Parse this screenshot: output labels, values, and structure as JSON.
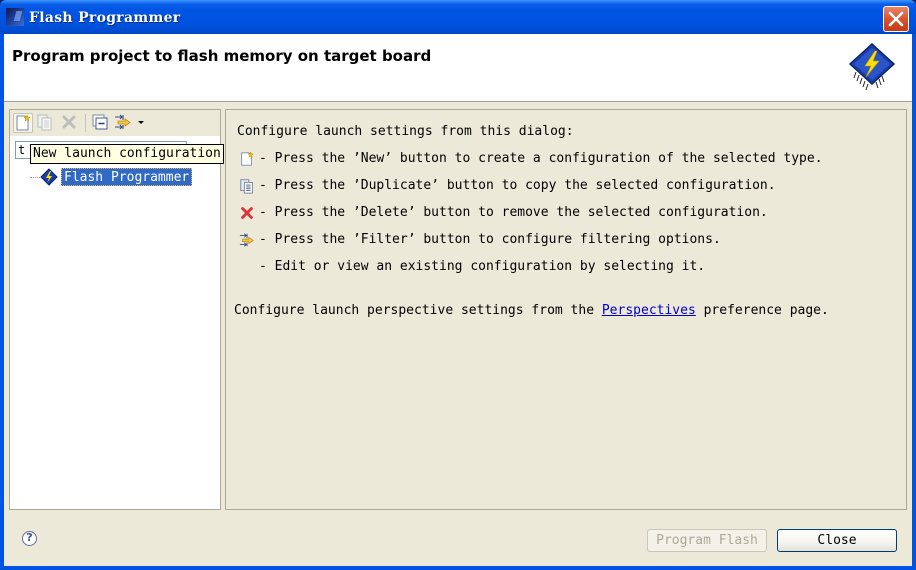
{
  "window": {
    "title": "Flash Programmer",
    "app_icon": "flash-programmer-app-icon",
    "close_icon": "close-icon"
  },
  "header": {
    "title": "Program project to flash memory on target board",
    "icon": "flash-chip-icon"
  },
  "toolbar": {
    "buttons": [
      {
        "name": "new-launch-config",
        "icon": "new-config-icon",
        "enabled": true
      },
      {
        "name": "duplicate",
        "icon": "duplicate-icon",
        "enabled": false
      },
      {
        "name": "delete",
        "icon": "delete-icon",
        "enabled": false
      },
      {
        "name": "collapse-all",
        "icon": "collapse-all-icon",
        "enabled": true
      },
      {
        "name": "filter",
        "icon": "filter-icon",
        "enabled": true
      },
      {
        "name": "view-menu",
        "icon": "dropdown-arrow-icon",
        "enabled": true
      }
    ]
  },
  "filter": {
    "value": "t"
  },
  "tooltip": {
    "text": "New launch configuration"
  },
  "tree": {
    "items": [
      {
        "label": "Flash Programmer",
        "icon": "flash-programmer-icon",
        "selected": true
      }
    ]
  },
  "content": {
    "intro": "Configure launch settings from this dialog:",
    "lines": [
      {
        "icon": "new-config-icon",
        "text": "- Press the ’New’ button to create a configuration of the selected type."
      },
      {
        "icon": "duplicate-icon",
        "text": "- Press the ’Duplicate’ button to copy the selected configuration."
      },
      {
        "icon": "delete-icon",
        "text": "- Press the ’Delete’ button to remove the selected configuration."
      },
      {
        "icon": "filter-icon",
        "text": "- Press the ’Filter’ button to configure filtering options."
      },
      {
        "icon": "",
        "text": "- Edit or view an existing configuration by selecting it."
      }
    ],
    "perspective_prefix": "Configure launch perspective settings from the ",
    "perspective_link": "Perspectives",
    "perspective_suffix": " preference page."
  },
  "footer": {
    "help_icon": "help-icon",
    "help_glyph": "?",
    "program_flash_label": "Program Flash",
    "program_flash_enabled": false,
    "close_label": "Close"
  }
}
